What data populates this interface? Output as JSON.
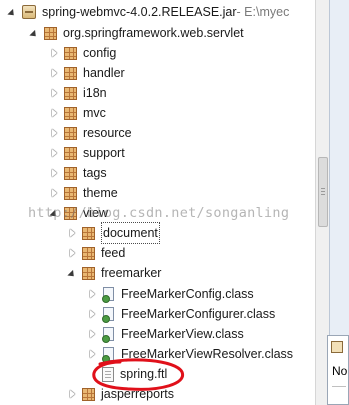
{
  "tree": {
    "jar": {
      "label": "spring-webmvc-4.0.2.RELEASE.jar",
      "path": " - E:\\myec"
    },
    "root_package": "org.springframework.web.servlet",
    "packages": [
      "config",
      "handler",
      "i18n",
      "mvc",
      "resource",
      "support",
      "tags",
      "theme"
    ],
    "view": "view",
    "view_children": [
      "document",
      "feed"
    ],
    "freemarker": "freemarker",
    "freemarker_classes": [
      "FreeMarkerConfig.class",
      "FreeMarkerConfigurer.class",
      "FreeMarkerView.class",
      "FreeMarkerViewResolver.class"
    ],
    "ftl_file": "spring.ftl",
    "after": "jasperreports"
  },
  "watermark": "http://blog.csdn.net/songanling",
  "side": {
    "label": "No"
  },
  "annotation": {
    "color": "#e0101a"
  }
}
